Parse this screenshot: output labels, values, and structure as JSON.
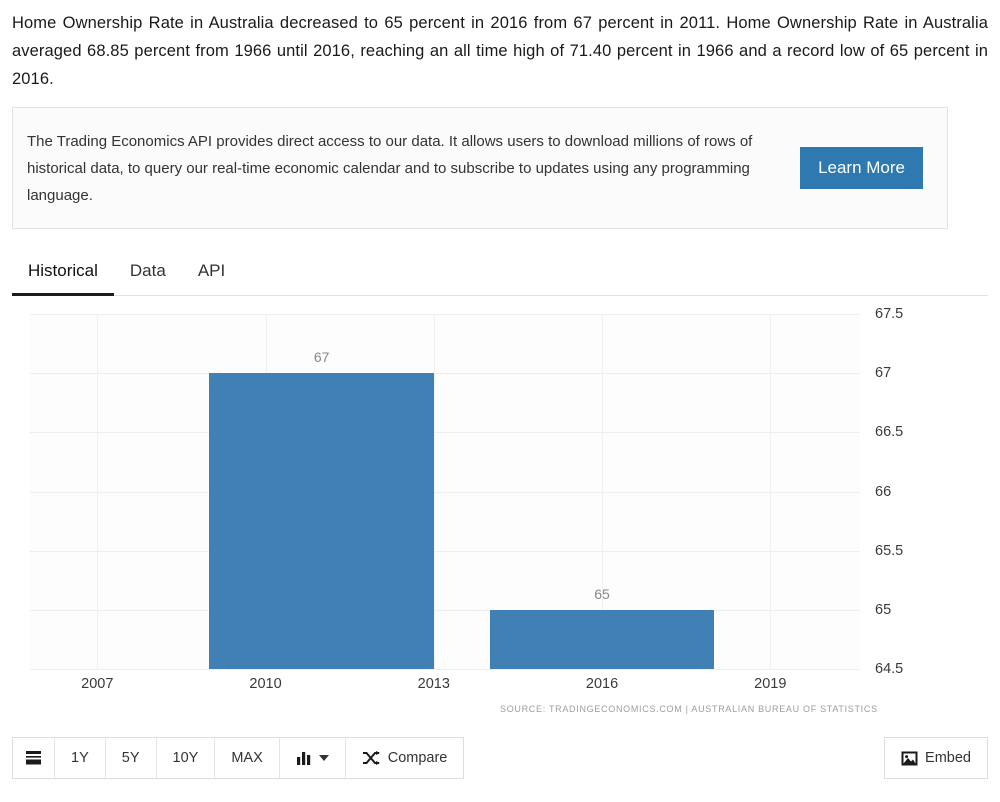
{
  "intro": {
    "paragraph": "Home Ownership Rate in Australia decreased to 65 percent in 2016 from 67 percent in 2011. Home Ownership Rate in Australia averaged 68.85 percent from 1966 until 2016, reaching an all time high of 71.40 percent in 1966 and a record low of 65 percent in 2016."
  },
  "api_panel": {
    "text": "The Trading Economics API provides direct access to our data. It allows users to download millions of rows of historical data, to query our real-time economic calendar and to subscribe to updates using any programming language.",
    "button_label": "Learn More",
    "button_color": "#2d79b0"
  },
  "tabs": [
    {
      "label": "Historical",
      "active": true
    },
    {
      "label": "Data",
      "active": false
    },
    {
      "label": "API",
      "active": false
    }
  ],
  "chart_data": {
    "type": "bar",
    "title": "",
    "xlabel": "",
    "ylabel": "",
    "categories": [
      "2011",
      "2016"
    ],
    "values": [
      67,
      65
    ],
    "bar_labels": [
      "67",
      "65"
    ],
    "series": [
      {
        "name": "Home Ownership Rate in Australia",
        "values": [
          67,
          65
        ]
      }
    ],
    "ylim": [
      64.5,
      67.5
    ],
    "yticks": [
      "67.5",
      "67",
      "66.5",
      "66",
      "65.5",
      "65",
      "64.5"
    ],
    "ytick_values": [
      67.5,
      67,
      66.5,
      66,
      65.5,
      65,
      64.5
    ],
    "xticks": [
      "2007",
      "2010",
      "2013",
      "2016",
      "2019"
    ],
    "xtick_values": [
      2007,
      2010,
      2013,
      2016,
      2019
    ],
    "xlim": [
      2005.8,
      2020.6
    ],
    "grid": true,
    "legend_position": "none",
    "bar_color": "#4180b4",
    "source_note": "SOURCE: TRADINGECONOMICS.COM  |  AUSTRALIAN BUREAU OF STATISTICS"
  },
  "toolbar": {
    "menu_icon": "list-icon",
    "ranges": [
      "1Y",
      "5Y",
      "10Y",
      "MAX"
    ],
    "chart_type_icon": "bar-chart-icon",
    "compare_icon": "shuffle-icon",
    "compare_label": "Compare",
    "embed_icon": "image-icon",
    "embed_label": "Embed"
  }
}
